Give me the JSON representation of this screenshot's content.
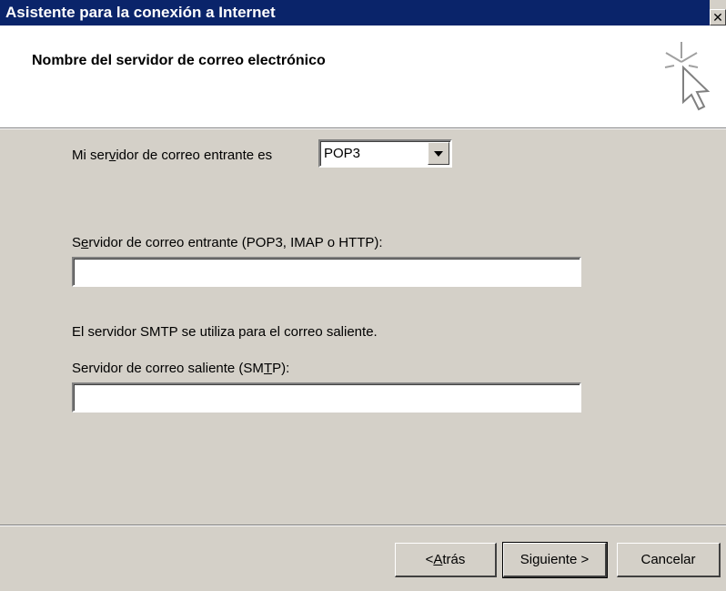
{
  "window": {
    "title": "Asistente para la conexión a Internet",
    "close_glyph": "✕"
  },
  "header": {
    "title": "Nombre del servidor de correo electrónico",
    "icon": "wizard-cursor-icon"
  },
  "form": {
    "incoming_type_label_pre": "Mi ser",
    "incoming_type_label_key": "v",
    "incoming_type_label_post": "idor de correo entrante es",
    "incoming_type_value": "POP3",
    "incoming_server_label_pre": "S",
    "incoming_server_label_key": "e",
    "incoming_server_label_post": "rvidor de correo entrante (POP3, IMAP o HTTP):",
    "incoming_server_value": "",
    "smtp_info": "El servidor SMTP se utiliza para el correo saliente.",
    "outgoing_server_label_pre": "Servidor de correo saliente (SM",
    "outgoing_server_label_key": "T",
    "outgoing_server_label_post": "P):",
    "outgoing_server_value": ""
  },
  "buttons": {
    "back_pre": "< ",
    "back_key": "A",
    "back_post": "trás",
    "next": "Siguiente >",
    "cancel": "Cancelar"
  }
}
